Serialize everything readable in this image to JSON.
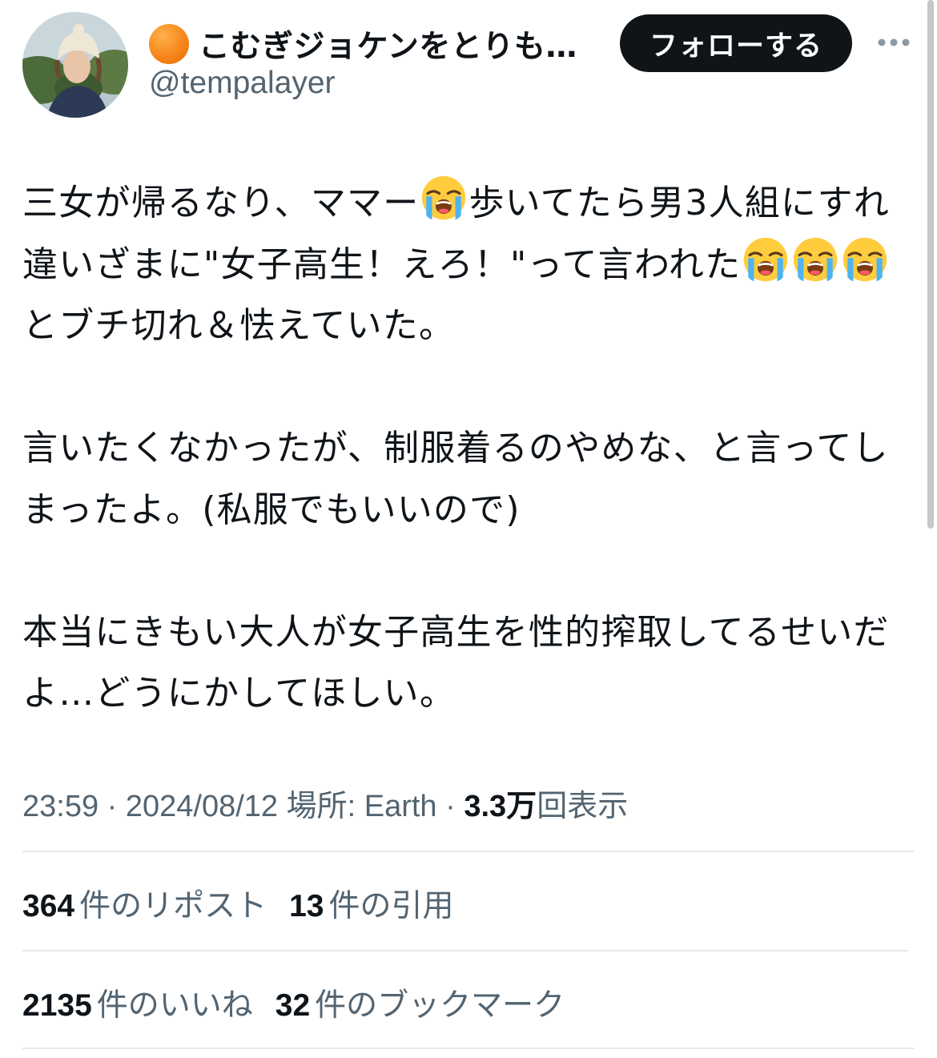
{
  "user": {
    "display_name": "こむぎジョケンをとりも…",
    "handle": "@tempalayer",
    "follow_label": "フォローする"
  },
  "tweet": {
    "p1_a": "三女が帰るなり、ママー",
    "p1_b": "歩いてたら男3人組にすれ違いざまに\"女子高生！えろ！\"って言われた",
    "p1_c": "とブチ切れ＆怯えていた。",
    "p2": "言いたくなかったが、制服着るのやめな、と言ってしまったよ。(私服でもいいので)",
    "p3": "本当にきもい大人が女子高生を性的搾取してるせいだよ…どうにかしてほしい。"
  },
  "meta": {
    "time": "23:59",
    "separator": " · ",
    "date": "2024/08/12",
    "location": "場所: Earth",
    "views_count": "3.3万",
    "views_label": "回表示"
  },
  "stats": {
    "reposts_count": "364",
    "reposts_label": "件のリポスト",
    "quotes_count": "13",
    "quotes_label": "件の引用",
    "likes_count": "2135",
    "likes_label": "件のいいね",
    "bookmarks_count": "32",
    "bookmarks_label": "件のブックマーク"
  },
  "icons": {
    "emoji": "loudly-crying-face-icon",
    "more": "more-horizontal-icon"
  },
  "colors": {
    "text": "#0f1419",
    "secondary": "#536471",
    "divider": "#e6e9eb",
    "orange": "#f7861b"
  }
}
